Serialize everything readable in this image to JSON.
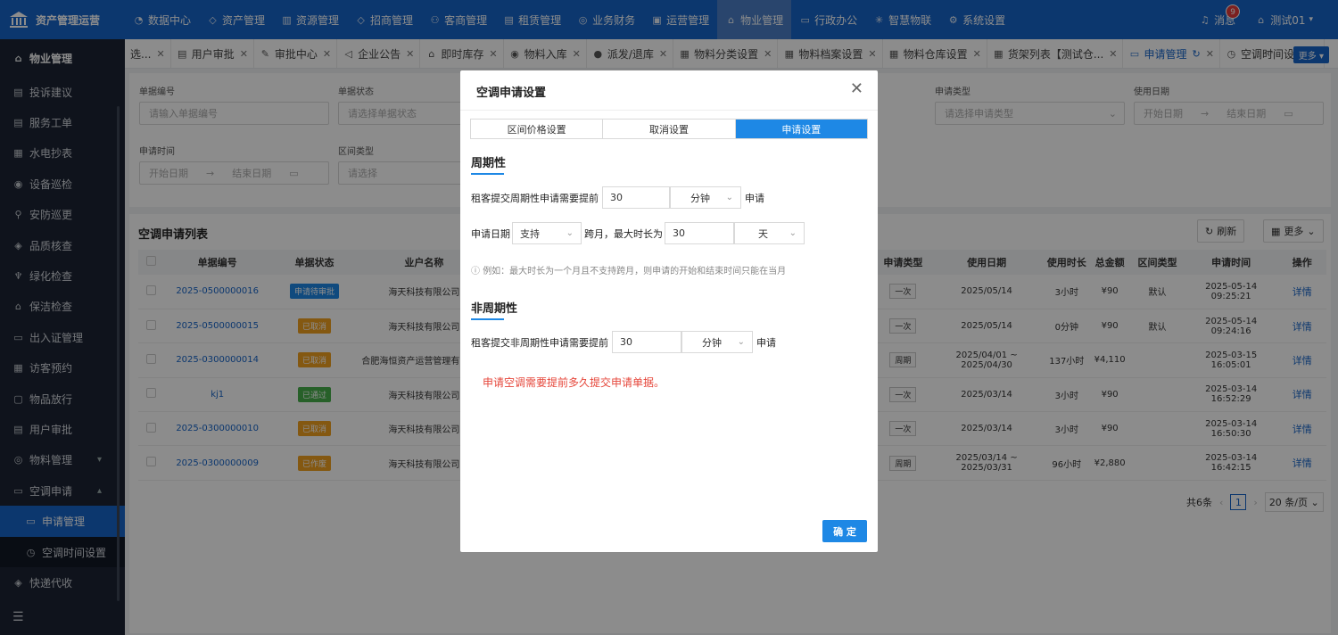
{
  "app": {
    "title": "资产管理运营"
  },
  "topnav": [
    {
      "label": "数据中心",
      "icon": "dashboard-icon"
    },
    {
      "label": "资产管理",
      "icon": "cube-icon"
    },
    {
      "label": "资源管理",
      "icon": "chart-icon"
    },
    {
      "label": "招商管理",
      "icon": "diamond-icon"
    },
    {
      "label": "客商管理",
      "icon": "users-icon"
    },
    {
      "label": "租赁管理",
      "icon": "contract-icon"
    },
    {
      "label": "业务财务",
      "icon": "money-icon"
    },
    {
      "label": "运营管理",
      "icon": "monitor-icon"
    },
    {
      "label": "物业管理",
      "icon": "home-icon"
    },
    {
      "label": "行政办公",
      "icon": "office-icon"
    },
    {
      "label": "智慧物联",
      "icon": "iot-icon"
    },
    {
      "label": "系统设置",
      "icon": "settings-icon"
    }
  ],
  "header_right": {
    "messages_label": "消息",
    "messages_count": "9",
    "user_name": "测试01"
  },
  "sidebar": {
    "head": "物业管理",
    "items": [
      {
        "label": "投诉建议",
        "icon": "complaint-icon"
      },
      {
        "label": "服务工单",
        "icon": "ticket-icon"
      },
      {
        "label": "水电抄表",
        "icon": "meter-icon"
      },
      {
        "label": "设备巡检",
        "icon": "device-icon"
      },
      {
        "label": "安防巡更",
        "icon": "patrol-icon"
      },
      {
        "label": "品质核查",
        "icon": "shield-icon"
      },
      {
        "label": "绿化检查",
        "icon": "plant-icon"
      },
      {
        "label": "保洁检查",
        "icon": "clean-icon"
      },
      {
        "label": "出入证管理",
        "icon": "pass-icon"
      },
      {
        "label": "访客预约",
        "icon": "visitor-icon"
      },
      {
        "label": "物品放行",
        "icon": "box-icon"
      },
      {
        "label": "用户审批",
        "icon": "approval-icon"
      },
      {
        "label": "物料管理",
        "icon": "material-icon"
      },
      {
        "label": "空调申请",
        "icon": "aircon-icon"
      }
    ],
    "sub_items": [
      {
        "label": "申请管理",
        "icon": "apply-icon"
      },
      {
        "label": "空调时间设置",
        "icon": "clock-icon"
      }
    ],
    "after": {
      "label": "快递代收",
      "icon": "express-icon"
    }
  },
  "tabs": [
    {
      "label": "选..."
    },
    {
      "label": "用户审批"
    },
    {
      "label": "审批中心"
    },
    {
      "label": "企业公告"
    },
    {
      "label": "即时库存"
    },
    {
      "label": "物料入库"
    },
    {
      "label": "派发/退库"
    },
    {
      "label": "物料分类设置"
    },
    {
      "label": "物料档案设置"
    },
    {
      "label": "物料仓库设置"
    },
    {
      "label": "货架列表【测试仓..."
    },
    {
      "label": "申请管理"
    },
    {
      "label": "空调时间设置"
    }
  ],
  "tabs_more": "更多",
  "filters": {
    "code_label": "单据编号",
    "code_placeholder": "请输入单据编号",
    "status_label": "单据状态",
    "status_placeholder": "请选择单据状态",
    "type_label": "申请类型",
    "type_placeholder": "请选择申请类型",
    "usedate_label": "使用日期",
    "start": "开始日期",
    "end": "结束日期",
    "applytime_label": "申请时间",
    "zone_label": "区间类型",
    "zone_placeholder": "请选择"
  },
  "list": {
    "title": "空调申请列表",
    "refresh": "刷新",
    "more": "更多",
    "left_headers": [
      "单据编号",
      "单据状态",
      "业户名称"
    ],
    "right_headers": [
      "申请类型",
      "使用日期",
      "使用时长",
      "总金额",
      "区间类型",
      "申请时间",
      "操作"
    ],
    "rows": [
      {
        "code": "2025-0500000016",
        "status": "申请待审批",
        "status_color": "blue",
        "owner": "海天科技有限公司",
        "type": "一次",
        "date": "2025/05/14",
        "duration": "3小时",
        "amount": "¥90",
        "zone": "默认",
        "time": "2025-05-14 09:25:21",
        "action": "详情"
      },
      {
        "code": "2025-0500000015",
        "status": "已取消",
        "status_color": "orange",
        "owner": "海天科技有限公司",
        "type": "一次",
        "date": "2025/05/14",
        "duration": "0分钟",
        "amount": "¥90",
        "zone": "默认",
        "time": "2025-05-14 09:24:16",
        "action": "详情"
      },
      {
        "code": "2025-0300000014",
        "status": "已取消",
        "status_color": "orange",
        "owner": "合肥海恒资产运营管理有限公司",
        "type": "周期",
        "date": "2025/04/01 ~ 2025/04/30",
        "duration": "137小时",
        "amount": "¥4,110",
        "zone": "",
        "time": "2025-03-15 16:05:01",
        "action": "详情"
      },
      {
        "code": "kj1",
        "status": "已通过",
        "status_color": "green",
        "owner": "海天科技有限公司",
        "type": "一次",
        "date": "2025/03/14",
        "duration": "3小时",
        "amount": "¥90",
        "zone": "",
        "time": "2025-03-14 16:52:29",
        "action": "详情"
      },
      {
        "code": "2025-0300000010",
        "status": "已取消",
        "status_color": "orange",
        "owner": "海天科技有限公司",
        "type": "一次",
        "date": "2025/03/14",
        "duration": "3小时",
        "amount": "¥90",
        "zone": "",
        "time": "2025-03-14 16:50:30",
        "action": "详情"
      },
      {
        "code": "2025-0300000009",
        "status": "已作废",
        "status_color": "orange",
        "owner": "海天科技有限公司",
        "type": "周期",
        "date": "2025/03/14 ~ 2025/03/31",
        "duration": "96小时",
        "amount": "¥2,880",
        "zone": "",
        "time": "2025-03-14 16:42:15",
        "action": "详情"
      }
    ],
    "pager": {
      "total": "共6条",
      "current": "1",
      "size": "20 条/页"
    }
  },
  "modal": {
    "title": "空调申请设置",
    "tabs": [
      "区间价格设置",
      "取消设置",
      "申请设置"
    ],
    "active_tab": "申请设置",
    "periodic": {
      "title": "周期性",
      "prefix": "租客提交周期性申请需要提前",
      "value": "30",
      "unit": "分钟",
      "suffix": "申请",
      "cross_label": "申请日期",
      "cross_value": "支持",
      "cross_text": "跨月，最大时长为",
      "max_value": "30",
      "max_unit": "天",
      "hint": "例如：最大时长为一个月且不支持跨月，则申请的开始和结束时间只能在当月"
    },
    "nonperiodic": {
      "title": "非周期性",
      "prefix": "租客提交非周期性申请需要提前",
      "value": "30",
      "unit": "分钟",
      "suffix": "申请"
    },
    "error": "申请空调需要提前多久提交申请单据。",
    "ok": "确 定"
  },
  "colors": {
    "primary": "#1664c9",
    "accent": "#1e88e5",
    "sidebar": "#1c2433",
    "error": "#e6473b"
  }
}
